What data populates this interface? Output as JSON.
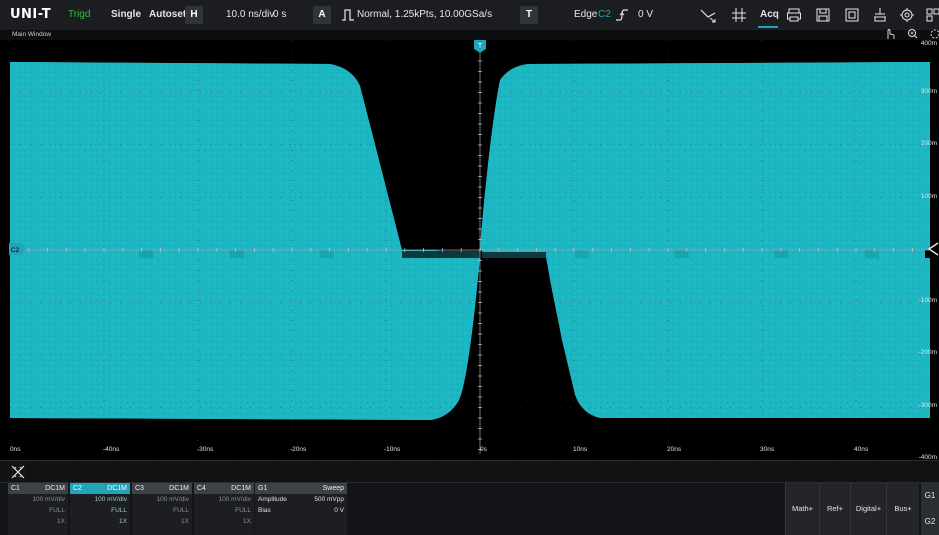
{
  "toolbar": {
    "logo": "UNI-T",
    "status": "Trigd",
    "single_label": "Single",
    "autoset_label": "Autoset",
    "h_label": "H",
    "timebase": "10.0 ns/div",
    "offset": "0 s",
    "a_label": "A",
    "acquire": "Normal, 1.25kPts, 10.00GSa/s",
    "t_label": "T",
    "trigger_type": "Edge",
    "trigger_source": "C2",
    "trigger_level": "0 V",
    "acq_label": "Acq"
  },
  "window_title": "Main Window",
  "x_labels": [
    "0ns",
    "-40ns",
    "-30ns",
    "-20ns",
    "-10ns",
    "0s",
    "10ns",
    "20ns",
    "30ns",
    "40ns"
  ],
  "y_labels": [
    "400m",
    "300m",
    "200m",
    "100m",
    "-100m",
    "-200m",
    "-300m",
    "-400m"
  ],
  "markers": {
    "trigger": "T",
    "channel": "C2"
  },
  "channels": [
    {
      "name": "C1",
      "coupling": "DC1M",
      "scale": "100 mV/div",
      "bw": "FULL",
      "probe": "1X"
    },
    {
      "name": "C2",
      "coupling": "DC1M",
      "scale": "100 mV/div",
      "bw": "FULL",
      "probe": "1X"
    },
    {
      "name": "C3",
      "coupling": "DC1M",
      "scale": "100 mV/div",
      "bw": "FULL",
      "probe": "1X"
    },
    {
      "name": "C4",
      "coupling": "DC1M",
      "scale": "100 mV/div",
      "bw": "FULL",
      "probe": "1X"
    }
  ],
  "generator": {
    "name": "G1",
    "mode": "Sweep",
    "amplitude_label": "Amplitude",
    "amplitude_value": "500 mVpp",
    "bias_label": "Bias",
    "bias_value": "0 V"
  },
  "right_buttons": [
    "Math+",
    "Ref+",
    "Digital+",
    "Bus+"
  ],
  "g_tabs": [
    "G1",
    "G2"
  ],
  "colors": {
    "trace": "#1db7c4",
    "active_channel": "#21a3b8",
    "trigd": "#2fbf3a",
    "background": "#000000"
  }
}
